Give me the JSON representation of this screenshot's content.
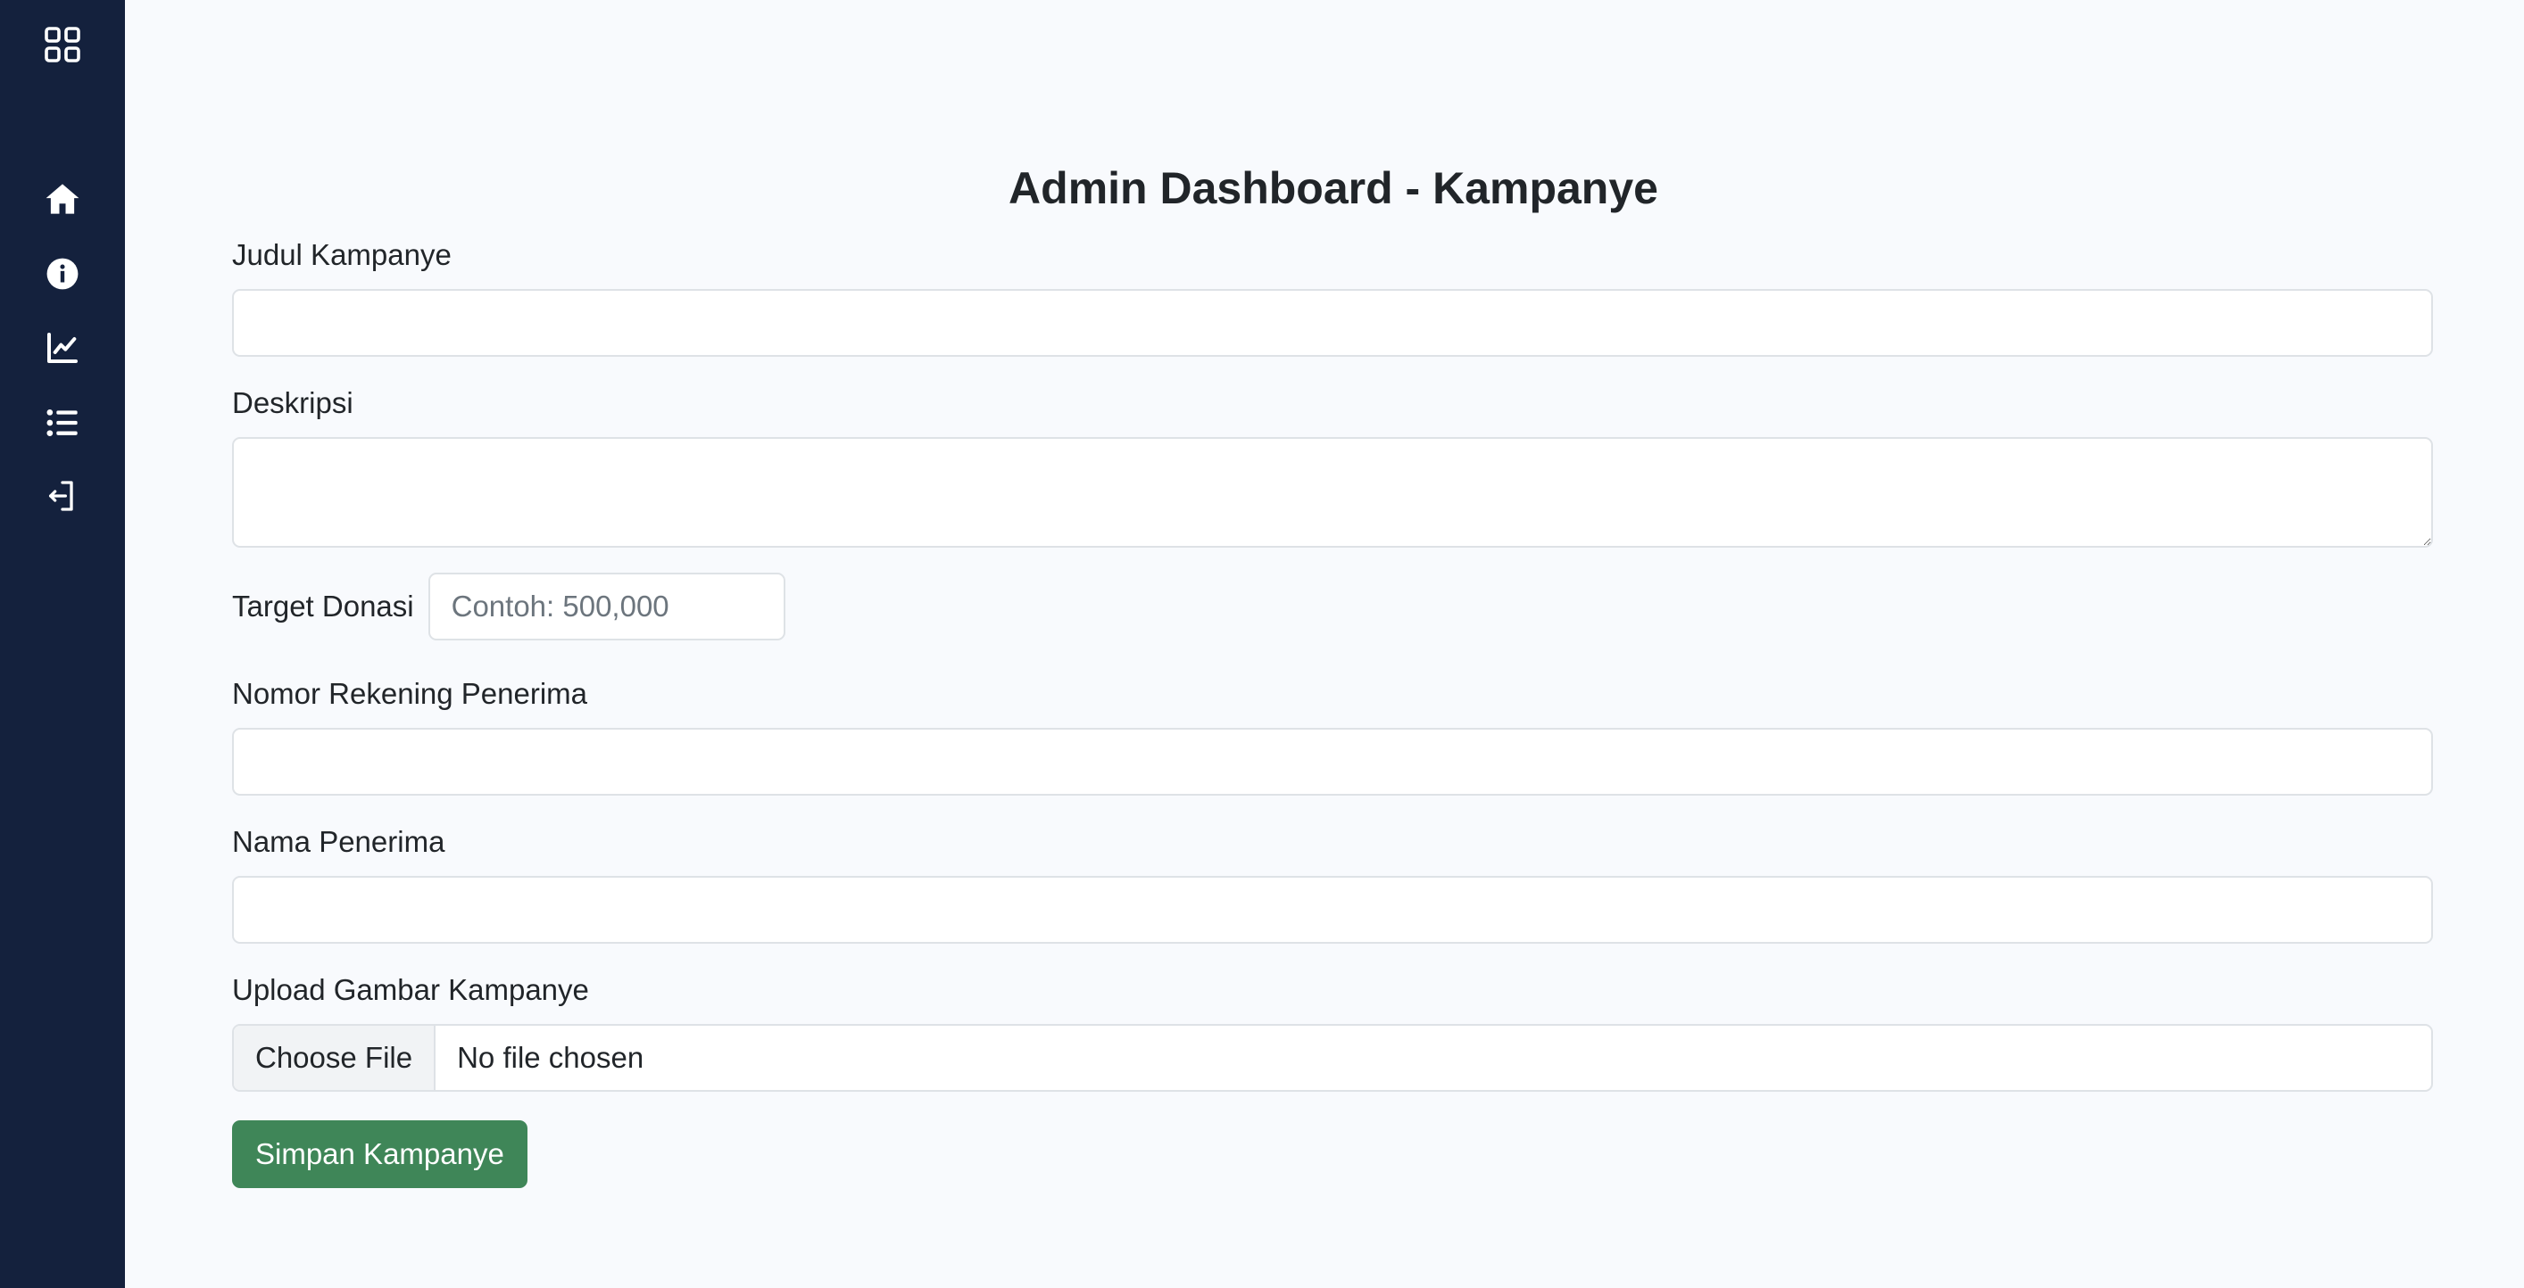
{
  "sidebar": {
    "items": [
      {
        "name": "apps-grid-icon"
      },
      {
        "name": "home-icon"
      },
      {
        "name": "info-icon"
      },
      {
        "name": "chart-line-icon"
      },
      {
        "name": "list-icon"
      },
      {
        "name": "logout-icon"
      }
    ],
    "colors": {
      "background": "#14213d",
      "icon": "#ffffff"
    }
  },
  "page": {
    "title": "Admin Dashboard - Kampanye"
  },
  "form": {
    "judul_label": "Judul Kampanye",
    "judul_value": "",
    "deskripsi_label": "Deskripsi",
    "deskripsi_value": "",
    "target_label": "Target Donasi",
    "target_placeholder": "Contoh: 500,000",
    "rekening_label": "Nomor Rekening Penerima",
    "rekening_value": "",
    "nama_label": "Nama Penerima",
    "nama_value": "",
    "upload_label": "Upload Gambar Kampanye",
    "file_button": "Choose File",
    "file_status": "No file chosen",
    "submit_label": "Simpan Kampanye"
  },
  "colors": {
    "accent": "#3f8658",
    "page_background": "#f8fafd"
  }
}
